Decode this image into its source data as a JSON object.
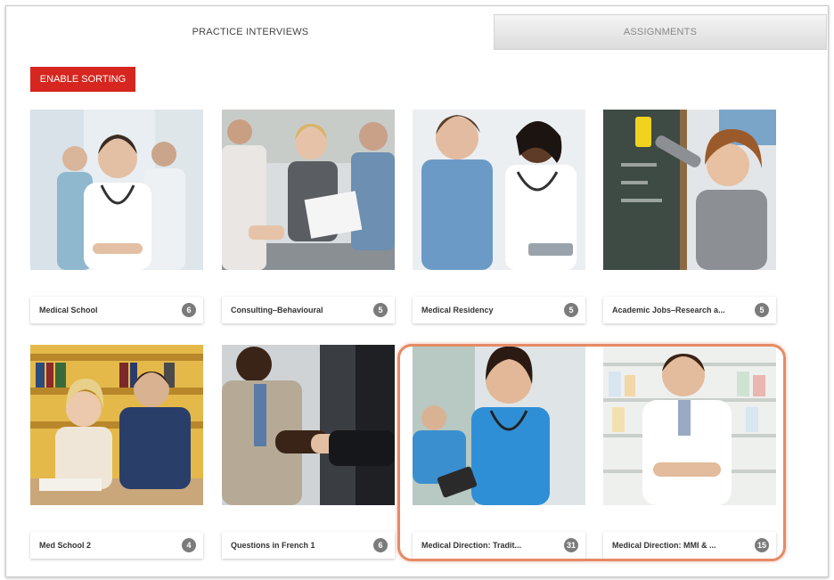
{
  "tabs": [
    {
      "label": "PRACTICE INTERVIEWS"
    },
    {
      "label": "ASSIGNMENTS"
    }
  ],
  "toolbar": {
    "enable_sorting_label": "ENABLE SORTING"
  },
  "accent_color": "#d6261f",
  "highlight_color": "#e58a66",
  "cards": [
    {
      "label": "Medical School",
      "count": "6"
    },
    {
      "label": "Consulting–Behavioural",
      "count": "5"
    },
    {
      "label": "Medical Residency",
      "count": "5"
    },
    {
      "label": "Academic Jobs–Research a...",
      "count": "5"
    },
    {
      "label": "Med School 2",
      "count": "4"
    },
    {
      "label": "Questions in French 1",
      "count": "6"
    },
    {
      "label": "Medical Direction: Tradit...",
      "count": "31"
    },
    {
      "label": "Medical Direction: MMI & ...",
      "count": "15"
    }
  ]
}
